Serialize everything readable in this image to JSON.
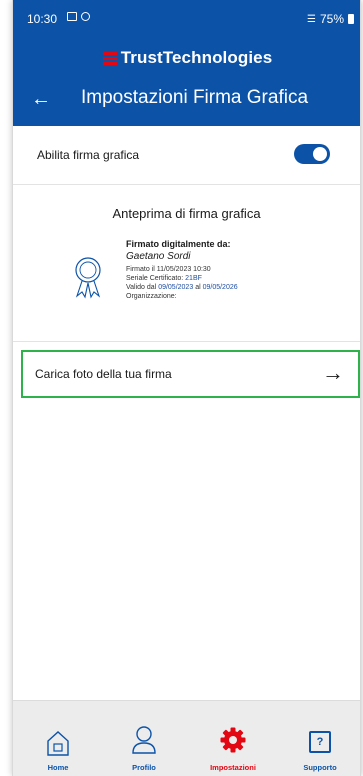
{
  "status_bar": {
    "time": "10:30",
    "battery": "75%"
  },
  "brand": {
    "name": "TrustTechnologies"
  },
  "header": {
    "back_icon": "arrow-left-icon",
    "title": "Impostazioni Firma Grafica"
  },
  "toggle": {
    "label": "Abilita firma grafica",
    "enabled": true
  },
  "preview": {
    "title": "Anteprima di firma grafica",
    "signed_by_label": "Firmato digitalmente da:",
    "signer_name": "Gaetano Sordi",
    "signed_on": "Firmato il 11/05/2023 10:30",
    "serial_label": "Seriale Certificato:",
    "serial_value": "21BF",
    "validity_label": "Valido dal",
    "valid_from": "09/05/2023",
    "validity_mid": "al",
    "valid_to": "09/05/2026",
    "organization_label": "Organizzazione:"
  },
  "upload": {
    "label": "Carica foto della tua firma",
    "arrow_icon": "arrow-right-icon"
  },
  "bottom_nav": {
    "items": [
      {
        "label": "Home",
        "icon": "home-icon",
        "active": false
      },
      {
        "label": "Profilo",
        "icon": "profile-icon",
        "active": false
      },
      {
        "label": "Impostazioni",
        "icon": "gear-icon",
        "active": true
      },
      {
        "label": "Supporto",
        "icon": "help-icon",
        "glyph": "?",
        "active": false
      }
    ]
  },
  "colors": {
    "primary": "#0c53a8",
    "accent": "#e30613",
    "highlight": "#2eb24a"
  }
}
